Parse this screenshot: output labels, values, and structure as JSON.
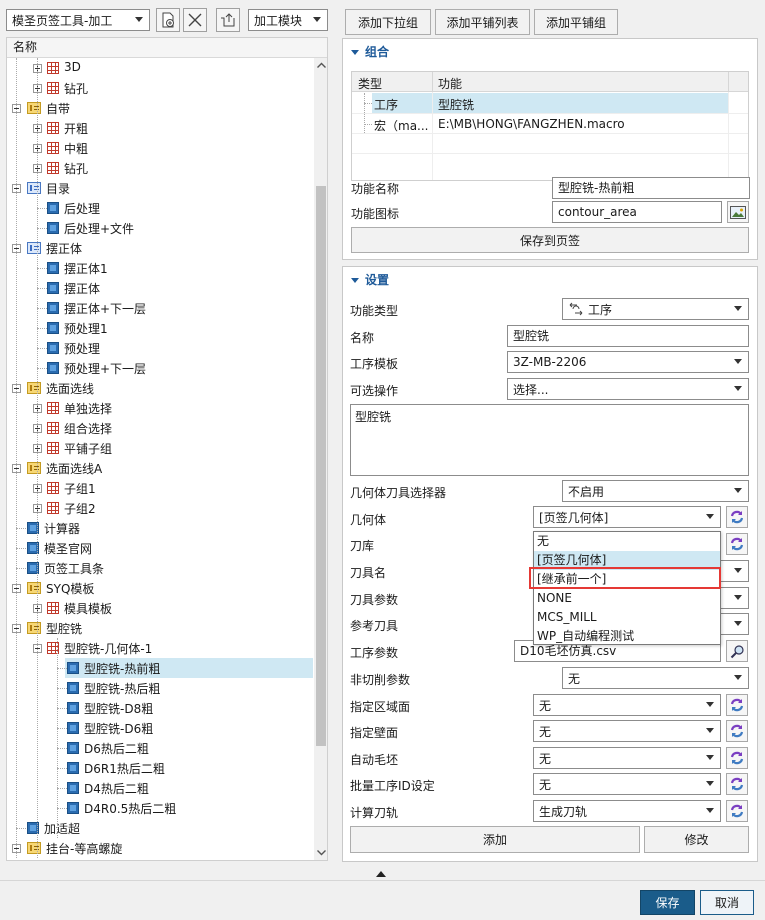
{
  "toolbar": {
    "tool_select": "模圣页签工具-加工",
    "module_select": "加工模块",
    "tabs": [
      "添加下拉组",
      "添加平铺列表",
      "添加平铺组"
    ]
  },
  "tree": {
    "header": "名称",
    "rows": [
      {
        "level": 2,
        "kind": "grid",
        "expander": "plus",
        "label": "3D"
      },
      {
        "level": 2,
        "kind": "grid",
        "expander": "plus",
        "label": "钻孔"
      },
      {
        "level": 1,
        "kind": "folder",
        "expander": "minus",
        "label": "自带"
      },
      {
        "level": 2,
        "kind": "grid",
        "expander": "plus",
        "label": "开粗"
      },
      {
        "level": 2,
        "kind": "grid",
        "expander": "plus",
        "label": "中粗"
      },
      {
        "level": 2,
        "kind": "grid",
        "expander": "plus",
        "label": "钻孔"
      },
      {
        "level": 1,
        "kind": "folderblue",
        "expander": "minus",
        "label": "目录"
      },
      {
        "level": 2,
        "kind": "leaf",
        "expander": "",
        "label": "后处理"
      },
      {
        "level": 2,
        "kind": "leaf",
        "expander": "",
        "label": "后处理+文件"
      },
      {
        "level": 1,
        "kind": "folderblue",
        "expander": "minus",
        "label": "摆正体"
      },
      {
        "level": 2,
        "kind": "leaf",
        "expander": "",
        "label": "摆正体1"
      },
      {
        "level": 2,
        "kind": "leaf",
        "expander": "",
        "label": "摆正体"
      },
      {
        "level": 2,
        "kind": "leaf",
        "expander": "",
        "label": "摆正体+下一层"
      },
      {
        "level": 2,
        "kind": "leaf",
        "expander": "",
        "label": "预处理1"
      },
      {
        "level": 2,
        "kind": "leaf",
        "expander": "",
        "label": "预处理"
      },
      {
        "level": 2,
        "kind": "leaf",
        "expander": "",
        "label": "预处理+下一层"
      },
      {
        "level": 1,
        "kind": "folder",
        "expander": "minus",
        "label": "选面选线"
      },
      {
        "level": 2,
        "kind": "grid",
        "expander": "plus",
        "label": "单独选择"
      },
      {
        "level": 2,
        "kind": "grid",
        "expander": "plus",
        "label": "组合选择"
      },
      {
        "level": 2,
        "kind": "grid",
        "expander": "plus",
        "label": "平铺子组"
      },
      {
        "level": 1,
        "kind": "folder",
        "expander": "minus",
        "label": "选面选线A"
      },
      {
        "level": 2,
        "kind": "grid",
        "expander": "plus",
        "label": "子组1"
      },
      {
        "level": 2,
        "kind": "grid",
        "expander": "plus",
        "label": "子组2"
      },
      {
        "level": 1,
        "kind": "leaf",
        "expander": "",
        "label": "计算器"
      },
      {
        "level": 1,
        "kind": "leaf",
        "expander": "",
        "label": "模圣官网"
      },
      {
        "level": 1,
        "kind": "leaf",
        "expander": "",
        "label": "页签工具条"
      },
      {
        "level": 1,
        "kind": "folder",
        "expander": "minus",
        "label": "SYQ模板"
      },
      {
        "level": 2,
        "kind": "grid",
        "expander": "plus",
        "label": "模具模板"
      },
      {
        "level": 1,
        "kind": "folder",
        "expander": "minus",
        "label": "型腔铣"
      },
      {
        "level": 2,
        "kind": "grid",
        "expander": "minus",
        "label": "型腔铣-几何体-1"
      },
      {
        "level": 3,
        "kind": "leaf",
        "expander": "",
        "label": "型腔铣-热前粗",
        "selected": true
      },
      {
        "level": 3,
        "kind": "leaf",
        "expander": "",
        "label": "型腔铣-热后粗"
      },
      {
        "level": 3,
        "kind": "leaf",
        "expander": "",
        "label": "型腔铣-D8粗"
      },
      {
        "level": 3,
        "kind": "leaf",
        "expander": "",
        "label": "型腔铣-D6粗"
      },
      {
        "level": 3,
        "kind": "leaf",
        "expander": "",
        "label": "D6热后二粗"
      },
      {
        "level": 3,
        "kind": "leaf",
        "expander": "",
        "label": "D6R1热后二粗"
      },
      {
        "level": 3,
        "kind": "leaf",
        "expander": "",
        "label": "D4热后二粗"
      },
      {
        "level": 3,
        "kind": "leaf",
        "expander": "",
        "label": "D4R0.5热后二粗"
      },
      {
        "level": 1,
        "kind": "leaf",
        "expander": "",
        "label": "加适超"
      },
      {
        "level": 1,
        "kind": "folder",
        "expander": "minus",
        "label": "挂台-等高螺旋"
      }
    ]
  },
  "group": {
    "title": "组合",
    "table_headers": [
      "类型",
      "功能"
    ],
    "table_rows": [
      {
        "type": "工序",
        "func": "型腔铣",
        "selected": true
      },
      {
        "type": "宏（ma...",
        "func": "E:\\MB\\HONG\\FANGZHEN.macro",
        "selected": false
      }
    ],
    "func_name_label": "功能名称",
    "func_name_value": "型腔铣-热前粗",
    "func_icon_label": "功能图标",
    "func_icon_value": "contour_area",
    "save_to_tab": "保存到页签"
  },
  "settings": {
    "title": "设置",
    "func_type_label": "功能类型",
    "func_type_value": "工序",
    "name_label": "名称",
    "name_value": "型腔铣",
    "template_label": "工序模板",
    "template_value": "3Z-MB-2206",
    "optional_label": "可选操作",
    "optional_value": "选择...",
    "textarea_value": "型腔铣",
    "geom_tool_label": "几何体刀具选择器",
    "geom_tool_value": "不启用",
    "geometry_label": "几何体",
    "geometry_value": "[页签几何体]",
    "toollib_label": "刀库",
    "toolname_label": "刀具名",
    "toolparam_label": "刀具参数",
    "reftool_label": "参考刀具",
    "opparam_label": "工序参数",
    "opparam_value": "D10毛坯仿真.csv",
    "noncut_label": "非切削参数",
    "noncut_value": "无",
    "area_label": "指定区域面",
    "area_value": "无",
    "wall_label": "指定壁面",
    "wall_value": "无",
    "blank_label": "自动毛坯",
    "blank_value": "无",
    "batchid_label": "批量工序ID设定",
    "batchid_value": "无",
    "calc_label": "计算刀轨",
    "calc_value": "生成刀轨",
    "add": "添加",
    "modify": "修改"
  },
  "dropdown_options": [
    "无",
    "[页签几何体]",
    "[继承前一个]",
    "NONE",
    "MCS_MILL",
    "WP_自动编程测试"
  ],
  "footer": {
    "save": "保存",
    "cancel": "取消"
  },
  "colors": {
    "accent": "#1e5a99",
    "primary_button": "#1a5c8a",
    "selection": "#cfe8f3",
    "highlight_border": "#e53935"
  }
}
